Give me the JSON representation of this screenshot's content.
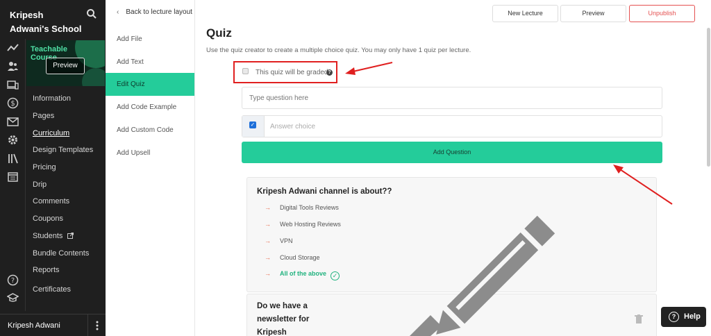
{
  "school": {
    "title": "Kripesh Adwani's School"
  },
  "course_thumb": {
    "title": "Teachable Course",
    "preview_label": "Preview"
  },
  "nav": {
    "information": "Information",
    "pages": "Pages",
    "curriculum": "Curriculum",
    "design_templates": "Design Templates",
    "pricing": "Pricing",
    "drip": "Drip",
    "comments": "Comments",
    "coupons": "Coupons",
    "students": "Students",
    "bundle_contents": "Bundle Contents",
    "reports": "Reports",
    "certificates": "Certificates"
  },
  "user": {
    "name": "Kripesh Adwani"
  },
  "subnav": {
    "back_label": "Back to lecture layout",
    "add_file": "Add File",
    "add_text": "Add Text",
    "edit_quiz": "Edit Quiz",
    "add_code_example": "Add Code Example",
    "add_custom_code": "Add Custom Code",
    "add_upsell": "Add Upsell"
  },
  "top_buttons": {
    "new_lecture": "New Lecture",
    "preview": "Preview",
    "unpublish": "Unpublish"
  },
  "quiz": {
    "title": "Quiz",
    "description": "Use the quiz creator to create a multiple choice quiz. You may only have 1 quiz per lecture.",
    "graded_label": "This quiz will be graded",
    "question_placeholder": "Type question here",
    "answer_placeholder": "Answer choice",
    "add_question_label": "Add Question"
  },
  "questions": [
    {
      "text": "Kripesh Adwani channel is about??",
      "answers": [
        "Digital Tools Reviews",
        "Web Hosting Reviews",
        "VPN",
        "Cloud Storage",
        "All of the above"
      ],
      "correct_index": 4
    },
    {
      "text": "Do we have a newsletter for Kripesh Adwani"
    }
  ],
  "help": {
    "label": "Help"
  },
  "colors": {
    "accent": "#24cc9a",
    "danger": "#e45050",
    "sidebar_bg": "#1f1f1f",
    "annotation_red": "#e01f1f"
  }
}
